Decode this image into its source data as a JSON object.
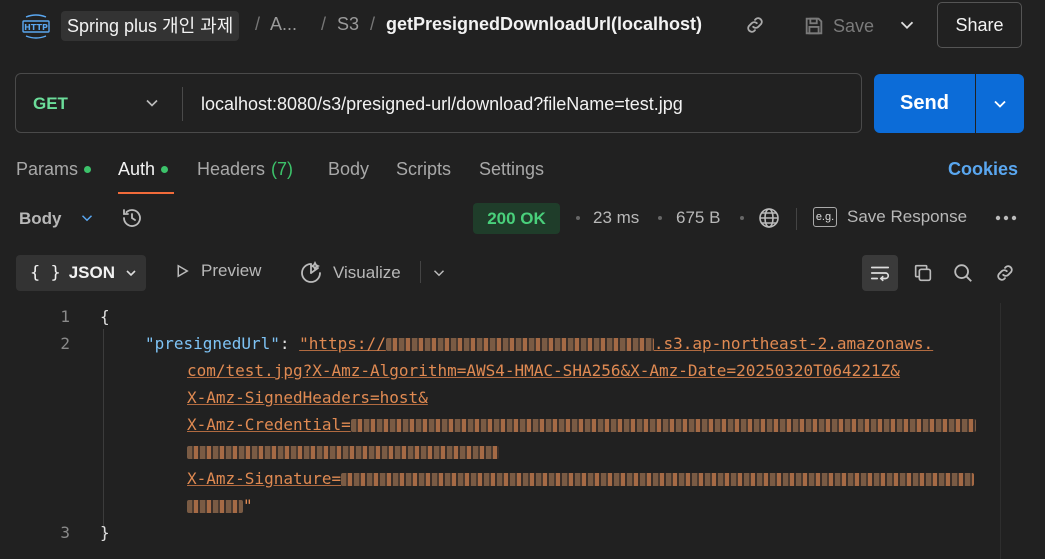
{
  "topbar": {
    "http_badge": "HTTP",
    "workspace": "Spring plus 개인 과제",
    "crumb_ellipsis": "A...",
    "crumb_folder": "S3",
    "request_title": "getPresignedDownloadUrl(localhost)",
    "save_label": "Save",
    "share_label": "Share"
  },
  "request": {
    "method": "GET",
    "url": "localhost:8080/s3/presigned-url/download?fileName=test.jpg",
    "send_label": "Send"
  },
  "tabs": {
    "params": "Params",
    "auth": "Auth",
    "headers": "Headers",
    "headers_count": "(7)",
    "body": "Body",
    "scripts": "Scripts",
    "settings": "Settings",
    "cookies": "Cookies"
  },
  "response": {
    "body_label": "Body",
    "status": "200 OK",
    "time": "23 ms",
    "size": "675 B",
    "save_response": "Save Response",
    "format": "JSON",
    "preview": "Preview",
    "visualize": "Visualize",
    "lines": {
      "l1": "1",
      "l2": "2",
      "l3": "3",
      "open_brace": "{",
      "close_brace": "}",
      "key": "\"presignedUrl\"",
      "colon": ": ",
      "url_start": "\"https://",
      "url_host": ".s3.ap-northeast-2.amazonaws.",
      "url_line2": "com/test.jpg?X-Amz-Algorithm=AWS4-HMAC-SHA256&X-Amz-Date=20250320T064221Z&",
      "url_line3": "X-Amz-SignedHeaders=host&",
      "url_line4": "X-Amz-Credential=",
      "url_line6": "X-Amz-Signature=",
      "url_end": "\""
    }
  },
  "colors": {
    "accent_blue": "#0c6cd8",
    "method_green": "#6bdd9a",
    "status_green": "#49d07b",
    "active_tab_orange": "#f26b3a",
    "cookies_blue": "#5aa7f0"
  }
}
